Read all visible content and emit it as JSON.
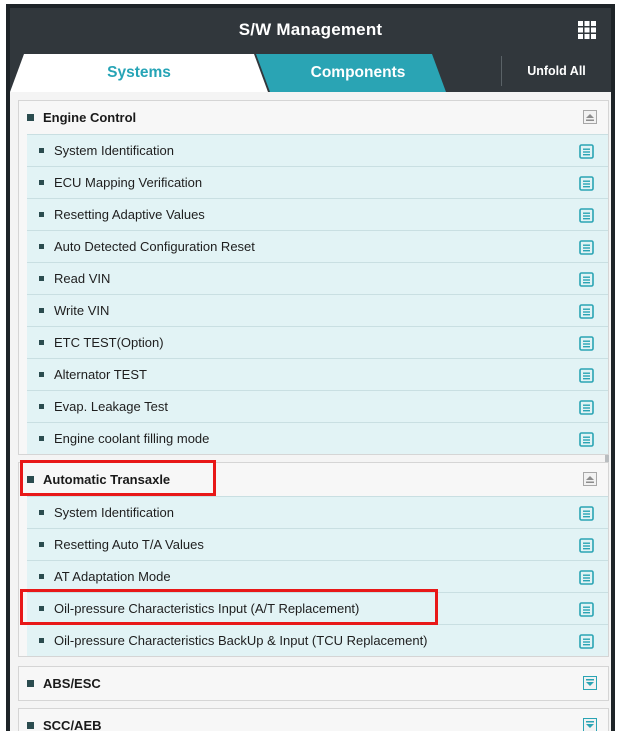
{
  "header": {
    "title": "S/W Management",
    "menu_icon": "grid-icon"
  },
  "tabs": [
    {
      "label": "Systems",
      "active": true
    },
    {
      "label": "Components",
      "active": false
    }
  ],
  "unfold_all_label": "Unfold All",
  "colors": {
    "accent": "#2aa4b4",
    "highlight": "#e81818",
    "item_bg": "#e2f3f5",
    "header_bg": "#31373c"
  },
  "groups": [
    {
      "title": "Engine Control",
      "expanded": true,
      "items": [
        "System Identification",
        "ECU Mapping Verification",
        "Resetting Adaptive Values",
        "Auto Detected Configuration Reset",
        "Read VIN",
        "Write VIN",
        "ETC TEST(Option)",
        "Alternator TEST",
        "Evap. Leakage Test",
        "Engine coolant filling mode"
      ]
    },
    {
      "title": "Automatic Transaxle",
      "expanded": true,
      "items": [
        "System Identification",
        "Resetting Auto T/A Values",
        "AT Adaptation Mode",
        "Oil-pressure Characteristics Input (A/T Replacement)",
        "Oil-pressure Characteristics BackUp & Input (TCU Replacement)"
      ]
    },
    {
      "title": "ABS/ESC",
      "expanded": false,
      "items": []
    },
    {
      "title": "SCC/AEB",
      "expanded": false,
      "items": []
    }
  ]
}
